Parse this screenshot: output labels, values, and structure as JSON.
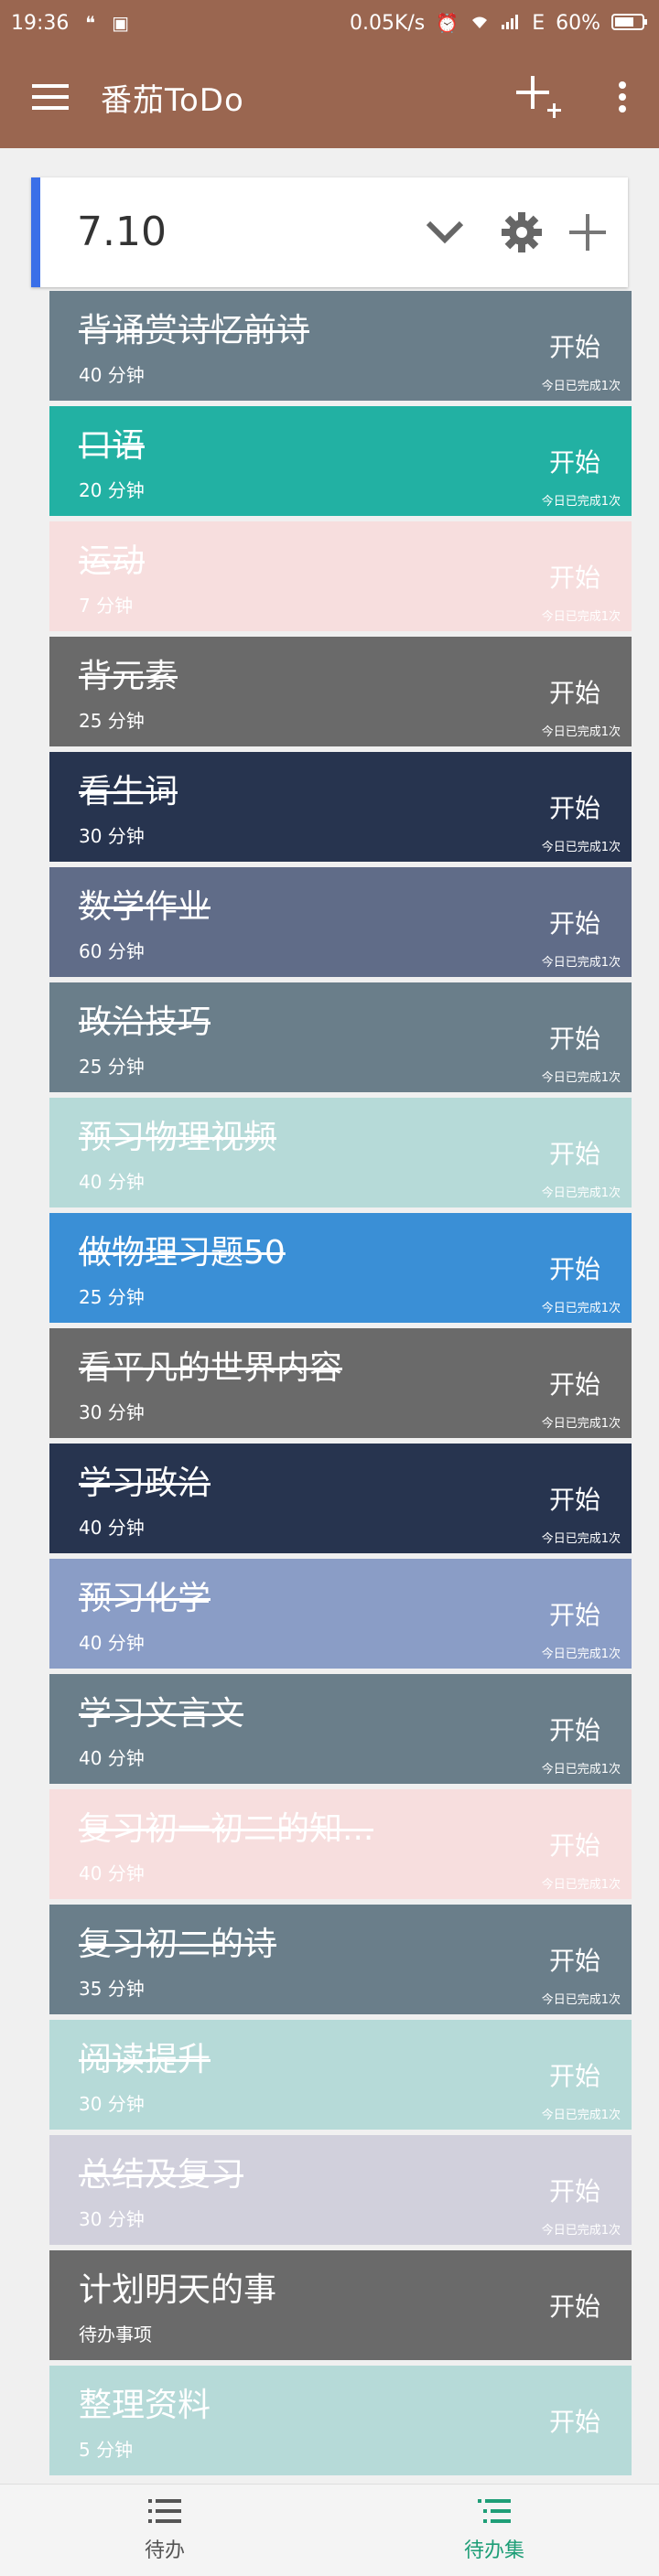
{
  "status": {
    "time": "19:36",
    "speed": "0.05K/s",
    "network": "E",
    "battery": "60%"
  },
  "appbar": {
    "title": "番茄ToDo",
    "menu_icon": "hamburger-icon",
    "add_icon": "add-collection-icon",
    "more_icon": "more-vert-icon"
  },
  "collection": {
    "title": "7.10",
    "accent": "#3a6fe8"
  },
  "items": [
    {
      "name": "背诵赏诗忆前诗",
      "duration": "40 分钟",
      "action": "开始",
      "count": "今日已完成1次",
      "color": "#6a7e8a",
      "done": true
    },
    {
      "name": "口语",
      "duration": "20 分钟",
      "action": "开始",
      "count": "今日已完成1次",
      "color": "#22b1a3",
      "done": true
    },
    {
      "name": "运动",
      "duration": "7 分钟",
      "action": "开始",
      "count": "今日已完成1次",
      "color": "#f7dede",
      "done": true
    },
    {
      "name": "背元素",
      "duration": "25 分钟",
      "action": "开始",
      "count": "今日已完成1次",
      "color": "#6a6a6a",
      "done": true
    },
    {
      "name": "看生词",
      "duration": "30 分钟",
      "action": "开始",
      "count": "今日已完成1次",
      "color": "#27344f",
      "done": true
    },
    {
      "name": "数学作业",
      "duration": "60 分钟",
      "action": "开始",
      "count": "今日已完成1次",
      "color": "#606c88",
      "done": true
    },
    {
      "name": "政治技巧",
      "duration": "25 分钟",
      "action": "开始",
      "count": "今日已完成1次",
      "color": "#6a7e8a",
      "done": true
    },
    {
      "name": "预习物理视频",
      "duration": "40 分钟",
      "action": "开始",
      "count": "今日已完成1次",
      "color": "#b6dad8",
      "done": true
    },
    {
      "name": "做物理习题50",
      "duration": "25 分钟",
      "action": "开始",
      "count": "今日已完成1次",
      "color": "#3a8fd6",
      "done": true
    },
    {
      "name": "看平凡的世界内容",
      "duration": "30 分钟",
      "action": "开始",
      "count": "今日已完成1次",
      "color": "#6a6a6a",
      "done": true
    },
    {
      "name": "学习政治",
      "duration": "40 分钟",
      "action": "开始",
      "count": "今日已完成1次",
      "color": "#27344f",
      "done": true
    },
    {
      "name": "预习化学",
      "duration": "40 分钟",
      "action": "开始",
      "count": "今日已完成1次",
      "color": "#8a9dc6",
      "done": true
    },
    {
      "name": "学习文言文",
      "duration": "40 分钟",
      "action": "开始",
      "count": "今日已完成1次",
      "color": "#6a7e8a",
      "done": true
    },
    {
      "name": "复习初一初二的知...",
      "duration": "40 分钟",
      "action": "开始",
      "count": "今日已完成1次",
      "color": "#f7dede",
      "done": true
    },
    {
      "name": "复习初二的诗",
      "duration": "35 分钟",
      "action": "开始",
      "count": "今日已完成1次",
      "color": "#6a7e8a",
      "done": true
    },
    {
      "name": "阅读提升",
      "duration": "30 分钟",
      "action": "开始",
      "count": "今日已完成1次",
      "color": "#b6dad8",
      "done": true
    },
    {
      "name": "总结及复习",
      "duration": "30 分钟",
      "action": "开始",
      "count": "今日已完成1次",
      "color": "#d1d0dc",
      "done": true
    },
    {
      "name": "计划明天的事",
      "duration": "待办事项",
      "action": "开始",
      "count": "",
      "color": "#6a6a6a",
      "done": false
    },
    {
      "name": "整理资料",
      "duration": "5 分钟",
      "action": "开始",
      "count": "",
      "color": "#b6dad8",
      "done": false
    }
  ],
  "bottom_nav": [
    {
      "label": "待办",
      "color": "#555555",
      "icon": "todo-list-icon"
    },
    {
      "label": "待办集",
      "color": "#1e9e77",
      "icon": "collection-list-icon"
    }
  ]
}
